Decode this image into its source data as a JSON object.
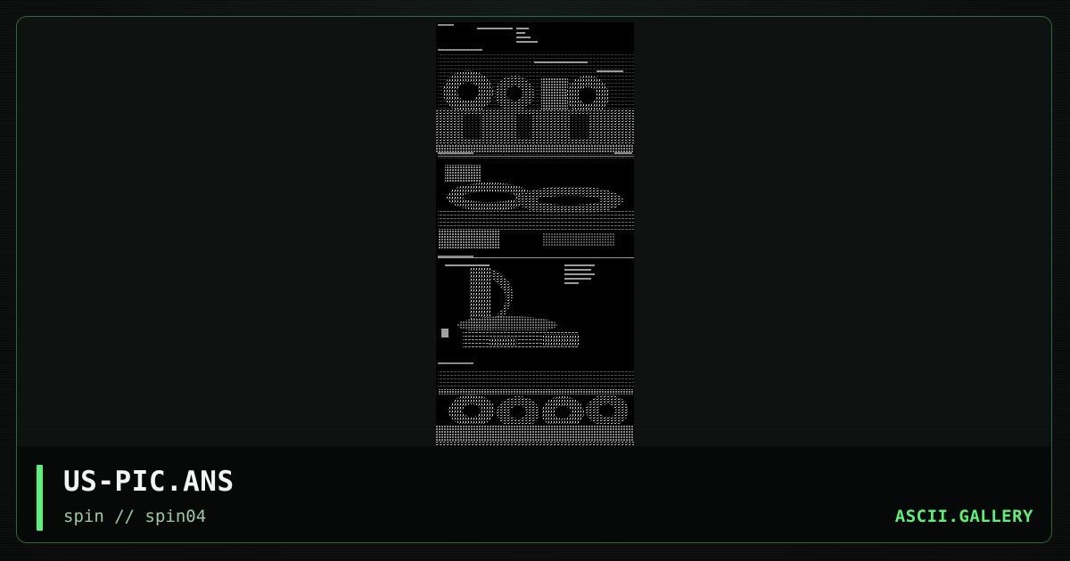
{
  "artwork": {
    "filename": "US-PIC.ANS",
    "group": "spin",
    "pack": "spin04",
    "subtitle": "spin // spin04",
    "preview_label": "ans-art-preview"
  },
  "site": {
    "name": "ASCII.GALLERY"
  },
  "colors": {
    "accent": "#5cf07a",
    "border": "#2c6b36",
    "background": "#0b0e0d",
    "title": "#f2f5f3",
    "subtitle": "#9bc9a4"
  }
}
